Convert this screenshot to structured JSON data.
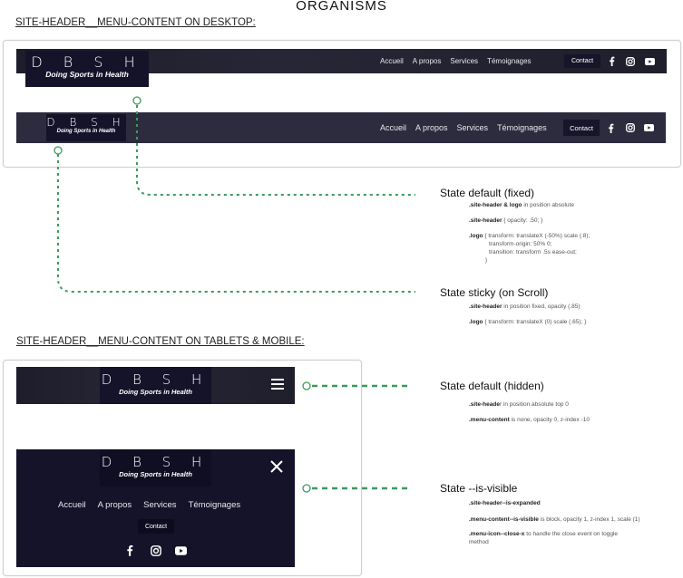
{
  "page_title": "ORGANISMS",
  "desktop": {
    "section_label": "SITE-HEADER__MENU-CONTENT  ON DESKTOP:",
    "logo_letters": "D B S H",
    "logo_tagline": "Doing Sports in Health",
    "nav_items": [
      "Accueil",
      "A propos",
      "Services",
      "Témoignages"
    ],
    "contact_label": "Contact",
    "social_icons": [
      "facebook-icon",
      "instagram-icon",
      "youtube-icon"
    ]
  },
  "mobile": {
    "section_label": "SITE-HEADER__MENU-CONTENT   ON TABLETS & MOBILE:",
    "logo_letters": "D B S H",
    "logo_tagline": "Doing Sports in Health",
    "nav_items": [
      "Accueil",
      "A propos",
      "Services",
      "Témoignages"
    ],
    "contact_label": "Contact",
    "menu_icon": "hamburger-icon",
    "close_icon": "close-icon"
  },
  "states": {
    "default_fixed": {
      "title": "State default (fixed)",
      "lines": [
        [
          ".site-header & logo",
          " in position absolute"
        ],
        [
          ".site-header",
          " {    opacity: .50;    }"
        ],
        [
          ".logo",
          " { transform: translateX (-50%) scale (.8);"
        ],
        [
          "",
          "transform-origin: 50% 0;"
        ],
        [
          "",
          "transition: transform .5s ease-out;"
        ],
        [
          "",
          "}"
        ]
      ]
    },
    "sticky": {
      "title": "State sticky (on Scroll)",
      "lines": [
        [
          ".site-header",
          "   in position fixed, opacity (.85)"
        ],
        [
          ".logo",
          " {    transform: translateX (0) scale (.65);    }"
        ]
      ]
    },
    "default_hidden": {
      "title": "State default (hidden)",
      "lines": [
        [
          ".site-heade",
          "r in position absolute top 0"
        ],
        [
          ".menu-content",
          "  is none, opacity 0, z-index -10"
        ]
      ]
    },
    "is_visible": {
      "title": "State --is-visible",
      "lines": [
        [
          ".site-header--is-expanded",
          ""
        ],
        [
          ".menu-content--is-visible",
          "  is block, opacity 1, z-index 1,  scale (1)"
        ],
        [
          ".menu-icon--close-x",
          "  to handle the close event on toggle"
        ],
        [
          "",
          "method"
        ]
      ]
    }
  },
  "colors": {
    "connector": "#3a9a5c",
    "bar_dark": "#1f1f2c",
    "bar_sticky": "#2c2c3e",
    "logo_bg": "#14132a",
    "mobile_menu_bg": "#141329"
  }
}
